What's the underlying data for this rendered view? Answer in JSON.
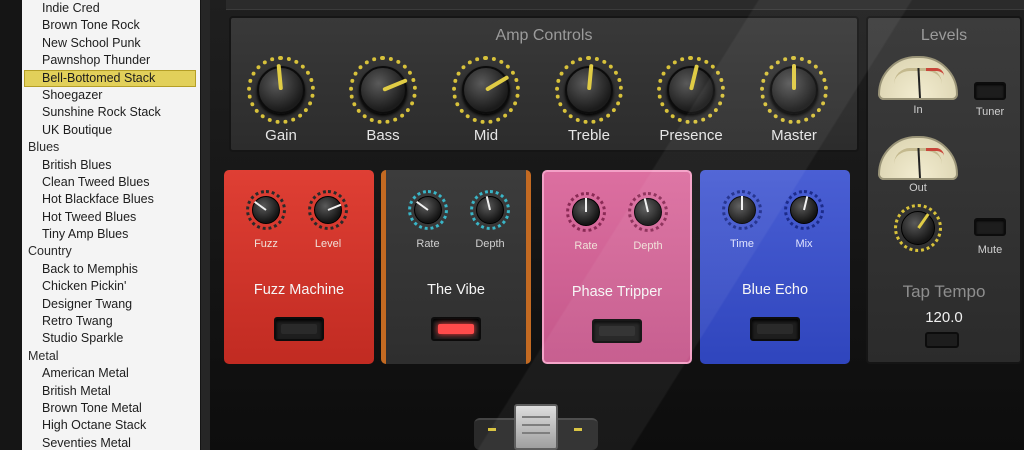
{
  "sidebar": {
    "groups": [
      {
        "category": "",
        "items": [
          "Indie Cred",
          "Brown Tone Rock",
          "New School Punk",
          "Pawnshop Thunder",
          "Bell-Bottomed Stack",
          "Shoegazer",
          "Sunshine Rock Stack",
          "UK Boutique"
        ]
      },
      {
        "category": "Blues",
        "items": [
          "British Blues",
          "Clean Tweed Blues",
          "Hot Blackface Blues",
          "Hot Tweed Blues",
          "Tiny Amp Blues"
        ]
      },
      {
        "category": "Country",
        "items": [
          "Back to Memphis",
          "Chicken Pickin'",
          "Designer Twang",
          "Retro Twang",
          "Studio Sparkle"
        ]
      },
      {
        "category": "Metal",
        "items": [
          "American Metal",
          "British Metal",
          "Brown Tone Metal",
          "High Octane Stack",
          "Seventies Metal"
        ]
      }
    ],
    "selected": "Bell-Bottomed Stack"
  },
  "amp": {
    "title": "Amp Controls",
    "knobs": [
      {
        "label": "Gain",
        "angle": 0.48
      },
      {
        "label": "Bass",
        "angle": 0.75
      },
      {
        "label": "Mid",
        "angle": 0.72
      },
      {
        "label": "Treble",
        "angle": 0.52
      },
      {
        "label": "Presence",
        "angle": 0.55
      },
      {
        "label": "Master",
        "angle": 0.5
      }
    ]
  },
  "pedals": [
    {
      "id": "fuzz",
      "name": "Fuzz Machine",
      "knobs": [
        {
          "label": "Fuzz",
          "angle": 0.3
        },
        {
          "label": "Level",
          "angle": 0.75
        }
      ],
      "active": false
    },
    {
      "id": "vibe",
      "name": "The Vibe",
      "knobs": [
        {
          "label": "Rate",
          "angle": 0.3
        },
        {
          "label": "Depth",
          "angle": 0.45
        }
      ],
      "active": true
    },
    {
      "id": "phase",
      "name": "Phase Tripper",
      "knobs": [
        {
          "label": "Rate",
          "angle": 0.5
        },
        {
          "label": "Depth",
          "angle": 0.45
        }
      ],
      "active": false
    },
    {
      "id": "echo",
      "name": "Blue Echo",
      "knobs": [
        {
          "label": "Time",
          "angle": 0.5
        },
        {
          "label": "Mix",
          "angle": 0.55
        }
      ],
      "active": false
    }
  ],
  "levels": {
    "title": "Levels",
    "in_label": "In",
    "out_label": "Out",
    "tuner_label": "Tuner",
    "mute_label": "Mute",
    "tap_tempo_label": "Tap Tempo",
    "tempo_value": "120.0"
  },
  "colors": {
    "accent_yellow": "#d8c23a",
    "selection": "#e2d05a",
    "fuzz_red": "#d63a30",
    "vibe_orange": "#c36a22",
    "phase_pink": "#d66a9a",
    "echo_blue": "#3d53c9"
  }
}
